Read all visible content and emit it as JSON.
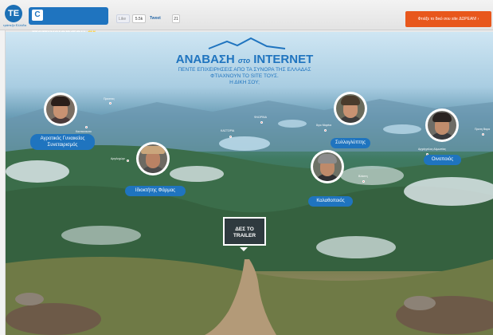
{
  "header": {
    "logo_text": "ΤΕ",
    "logo_sub": "τράπεζα Ελλάδα",
    "brand_c": "C",
    "brand_name": "πεπιχειρησου",
    "brand_tld": ".gr",
    "like_label": "Like",
    "like_count": "5.5k",
    "tweet_label": "Tweet",
    "tweet_count": "21",
    "cta_label": "Φτιάξε το δικό σου site ΔΩΡΕΑΝ! ›"
  },
  "hero": {
    "title_part1": "ΑΝΑΒΑΣΗ",
    "title_small": "στο",
    "title_part2": "INTERNET",
    "subtitle_line1": "ΠΕΝΤΕ ΕΠΙΧΕΙΡΗΣΕΙΣ ΑΠΟ ΤΑ ΣΥΝΟΡΑ ΤΗΣ ΕΛΛΑΔΑΣ",
    "subtitle_line2": "ΦΤΙΑΧΝΟΥΝ ΤΟ SITE ΤΟΥΣ.",
    "subtitle_line3": "Η ΔΙΚΗ ΣΟΥ;"
  },
  "people": [
    {
      "label_line1": "Αγροτικός Γυναικείος",
      "label_line2": "Συνεταιρισμός"
    },
    {
      "label": "Ιδιοκτήτης Φάρμας"
    },
    {
      "label": "Συλλογλύπτης"
    },
    {
      "label": "Καλαθοποιός"
    },
    {
      "label": "Οινοποιός"
    }
  ],
  "places": [
    "Πρεσπες",
    "Καστανουσα",
    "ΚΑΣΤΟΡΙΑ",
    "ΦΛΩΡΙΝΑ",
    "Άγιο Μαρίνα",
    "Αργιλοχώρι",
    "Αρχάγγελος Αλμωπίας",
    "Πρατη Βαρα",
    "Βλάστη"
  ],
  "trailer": {
    "line1": "ΔΕΣ ΤΟ",
    "line2": "TRAILER"
  },
  "colors": {
    "accent": "#1f74bf",
    "cta": "#e8571c"
  }
}
